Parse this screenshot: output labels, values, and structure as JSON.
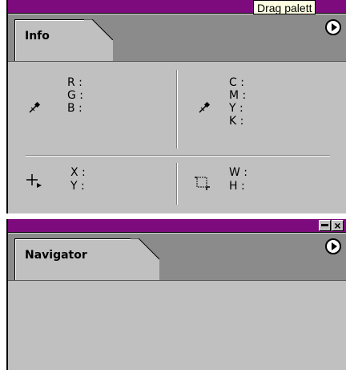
{
  "tooltip": "Drag palett",
  "info": {
    "tab_label": "Info",
    "rgb_labels": [
      "R :",
      "G :",
      "B :"
    ],
    "cmyk_labels": [
      "C :",
      "M :",
      "Y :",
      "K :"
    ],
    "xy_labels": [
      "X :",
      "Y :"
    ],
    "wh_labels": [
      "W :",
      "H :"
    ],
    "icons": [
      "eyedropper-icon",
      "eyedropper-icon",
      "crosshair-icon",
      "selection-size-icon"
    ]
  },
  "navigator": {
    "tab_label": "Navigator"
  },
  "colors": {
    "titlebar": "#7e0b7e",
    "panel_bg": "#c0c0c0",
    "tabstrip_bg": "#8b8b8b",
    "tooltip_bg": "#ffffe1"
  }
}
